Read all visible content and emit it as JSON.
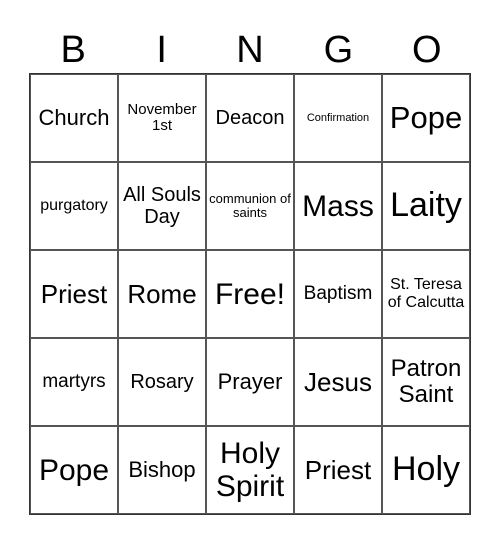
{
  "header": [
    "B",
    "I",
    "N",
    "G",
    "O"
  ],
  "cells": [
    {
      "text": "Church",
      "size": 22
    },
    {
      "text": "November 1st",
      "size": 15
    },
    {
      "text": "Deacon",
      "size": 20
    },
    {
      "text": "Confirmation",
      "size": 11
    },
    {
      "text": "Pope",
      "size": 31
    },
    {
      "text": "purgatory",
      "size": 16
    },
    {
      "text": "All Souls Day",
      "size": 20
    },
    {
      "text": "communion of saints",
      "size": 13
    },
    {
      "text": "Mass",
      "size": 30
    },
    {
      "text": "Laity",
      "size": 34
    },
    {
      "text": "Priest",
      "size": 26
    },
    {
      "text": "Rome",
      "size": 26
    },
    {
      "text": "Free!",
      "size": 30
    },
    {
      "text": "Baptism",
      "size": 19
    },
    {
      "text": "St. Teresa of Calcutta",
      "size": 16
    },
    {
      "text": "martyrs",
      "size": 19
    },
    {
      "text": "Rosary",
      "size": 20
    },
    {
      "text": "Prayer",
      "size": 22
    },
    {
      "text": "Jesus",
      "size": 26
    },
    {
      "text": "Patron Saint",
      "size": 24
    },
    {
      "text": "Pope",
      "size": 30
    },
    {
      "text": "Bishop",
      "size": 22
    },
    {
      "text": "Holy Spirit",
      "size": 30
    },
    {
      "text": "Priest",
      "size": 26
    },
    {
      "text": "Holy",
      "size": 34
    }
  ]
}
